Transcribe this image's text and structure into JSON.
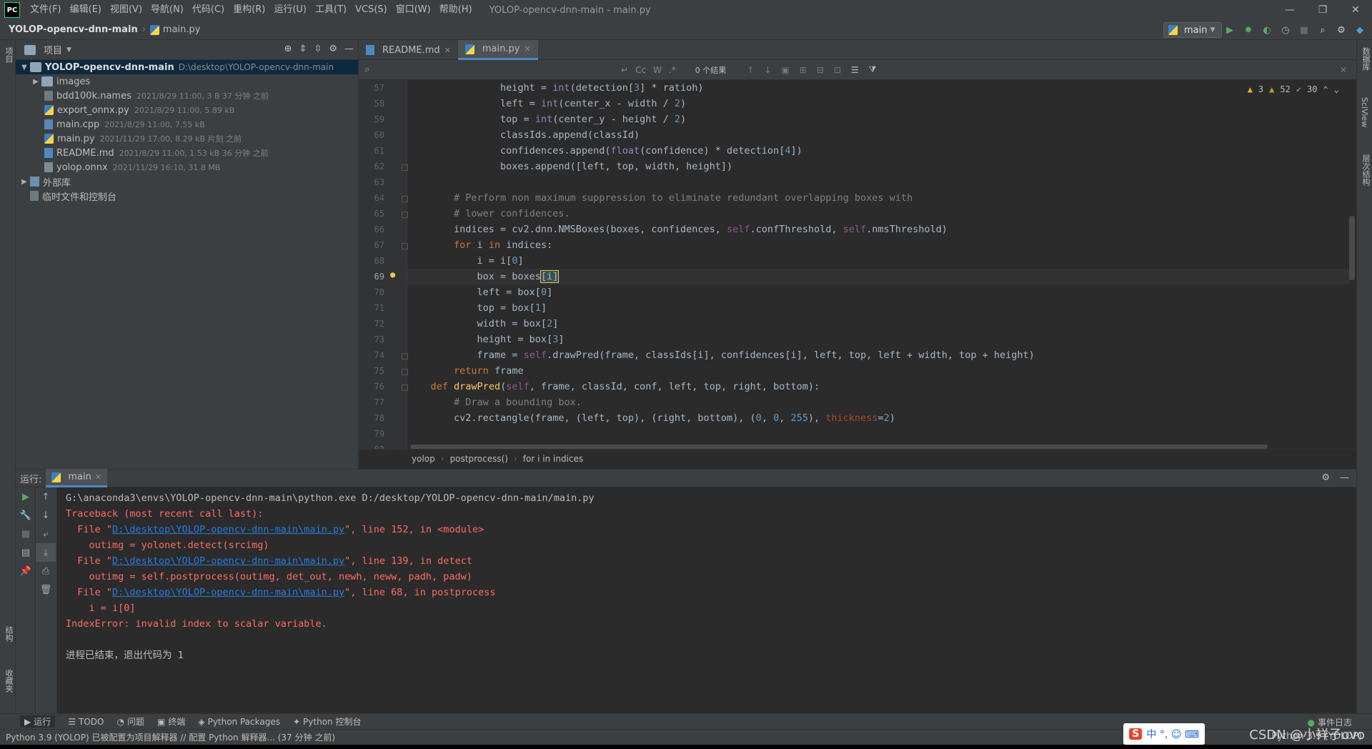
{
  "menu": {
    "logo": "PC",
    "items": [
      "文件(F)",
      "编辑(E)",
      "视图(V)",
      "导航(N)",
      "代码(C)",
      "重构(R)",
      "运行(U)",
      "工具(T)",
      "VCS(S)",
      "窗口(W)",
      "帮助(H)"
    ],
    "window_title": "YOLOP-opencv-dnn-main - main.py",
    "win_buttons": [
      "—",
      "❐",
      "✕"
    ]
  },
  "nav": {
    "project": "YOLOP-opencv-dnn-main",
    "file": "main.py",
    "run_config": "main"
  },
  "left_stripe": {
    "top": "项目",
    "bottom1": "结构",
    "bottom2": "收藏夹"
  },
  "right_stripe": {
    "a": "数据库",
    "b": "SciView",
    "c": "层次结构"
  },
  "project_panel": {
    "title": "项目",
    "root_name": "YOLOP-opencv-dnn-main",
    "root_path": "D:\\desktop\\YOLOP-opencv-dnn-main",
    "items": [
      {
        "name": "images",
        "meta": ""
      },
      {
        "name": "bdd100k.names",
        "meta": "2021/8/29 11:00, 3 B 37 分钟 之前"
      },
      {
        "name": "export_onnx.py",
        "meta": "2021/8/29 11:00, 5.89 kB"
      },
      {
        "name": "main.cpp",
        "meta": "2021/8/29 11:00, 7.55 kB"
      },
      {
        "name": "main.py",
        "meta": "2021/11/29 17:00, 8.29 kB 片刻 之前"
      },
      {
        "name": "README.md",
        "meta": "2021/8/29 11:00, 1.53 kB 36 分钟 之前"
      },
      {
        "name": "yolop.onnx",
        "meta": "2021/11/29 16:10, 31.8 MB"
      }
    ],
    "external_libs": "外部库",
    "scratches": "临时文件和控制台"
  },
  "tabs": [
    {
      "label": "README.md"
    },
    {
      "label": "main.py"
    }
  ],
  "search": {
    "placeholder": "",
    "case": "Cc",
    "word": "W",
    "regex": ".*",
    "result": "0 个结果"
  },
  "inspection": {
    "warnings": "3",
    "weak": "52",
    "ok": "30"
  },
  "editor": {
    "line_numbers": [
      "57",
      "58",
      "59",
      "60",
      "61",
      "62",
      "63",
      "64",
      "65",
      "66",
      "67",
      "68",
      "69",
      "70",
      "71",
      "72",
      "73",
      "74",
      "75",
      "76",
      "77",
      "78",
      "79",
      "80"
    ],
    "current_line": "69"
  },
  "breadcrumbs": [
    "yolop",
    "postprocess()",
    "for i in indices"
  ],
  "run": {
    "label": "运行:",
    "tab": "main",
    "console": {
      "cmd": "G:\\anaconda3\\envs\\YOLOP-opencv-dnn-main\\python.exe D:/desktop/YOLOP-opencv-dnn-main/main.py",
      "traceback": "Traceback (most recent call last):",
      "f1_pre": "  File \"",
      "f1_link": "D:\\desktop\\YOLOP-opencv-dnn-main\\main.py",
      "f1_post": "\", line 152, in <module>",
      "f1_code": "    outimg = yolonet.detect(srcimg)",
      "f2_pre": "  File \"",
      "f2_link": "D:\\desktop\\YOLOP-opencv-dnn-main\\main.py",
      "f2_post": "\", line 139, in detect",
      "f2_code": "    outimg = self.postprocess(outimg, det_out, newh, neww, padh, padw)",
      "f3_pre": "  File \"",
      "f3_link": "D:\\desktop\\YOLOP-opencv-dnn-main\\main.py",
      "f3_post": "\", line 68, in postprocess",
      "f3_code": "    i = i[0]",
      "error": "IndexError: invalid index to scalar variable.",
      "exit": "进程已结束，退出代码为 1"
    }
  },
  "bottom_tools": [
    "运行",
    "TODO",
    "问题",
    "终端",
    "Python Packages",
    "Python 控制台"
  ],
  "event_log": "事件日志",
  "status": {
    "message": "Python 3.9 (YOLOP) 已被配置为项目解释器 // 配置 Python 解释器... (37 分钟 之前)",
    "interpreter": "Python 3.9 (YOLOP)"
  },
  "ime": "中 °, ☺ ⌨",
  "watermark": "CSDN @小祥子ovo"
}
